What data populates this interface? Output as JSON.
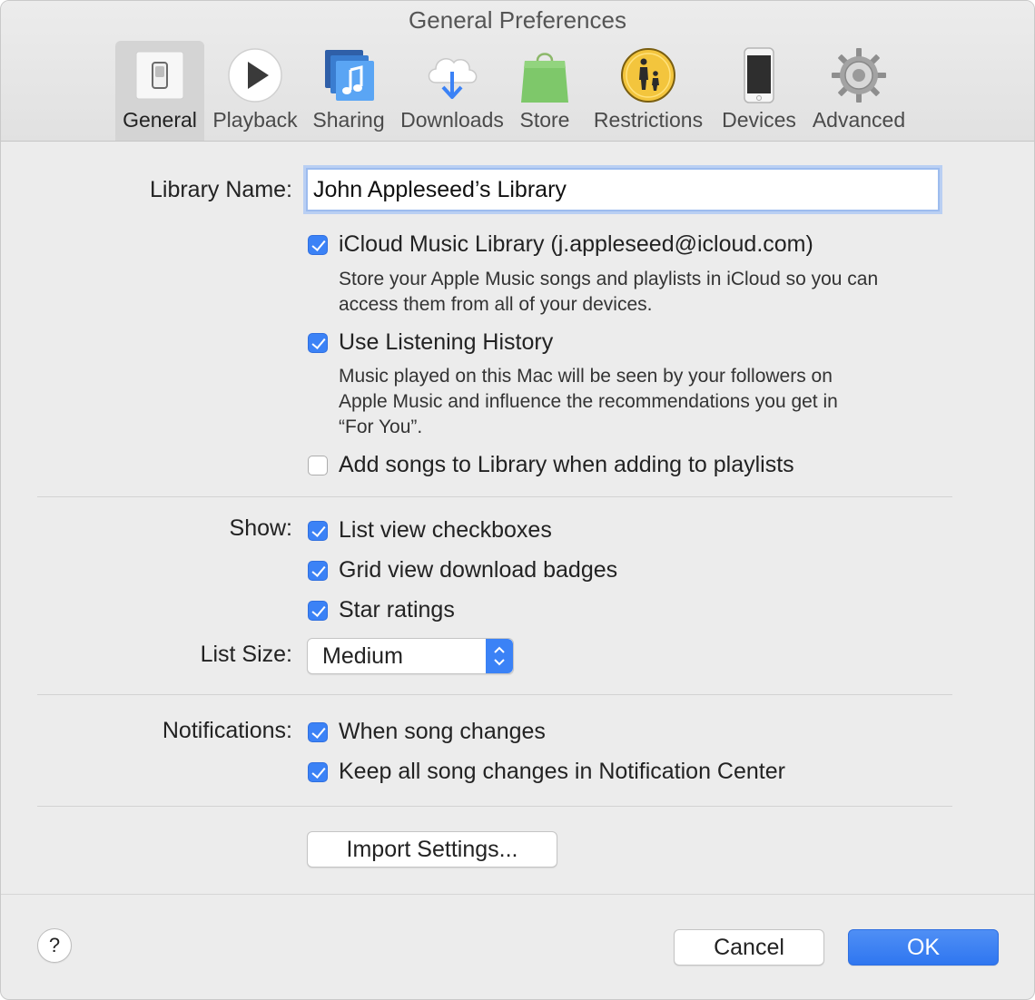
{
  "window": {
    "title": "General Preferences"
  },
  "toolbar": {
    "selected": "General",
    "tabs": [
      {
        "label": "General",
        "icon": "switch-icon"
      },
      {
        "label": "Playback",
        "icon": "play-icon"
      },
      {
        "label": "Sharing",
        "icon": "music-note-icon"
      },
      {
        "label": "Downloads",
        "icon": "cloud-download-icon"
      },
      {
        "label": "Store",
        "icon": "shopping-bag-icon"
      },
      {
        "label": "Restrictions",
        "icon": "parental-icon"
      },
      {
        "label": "Devices",
        "icon": "phone-icon"
      },
      {
        "label": "Advanced",
        "icon": "gear-icon"
      }
    ]
  },
  "library": {
    "label": "Library Name:",
    "value": "John Appleseed’s Library"
  },
  "options": {
    "icloud": {
      "label": "iCloud Music Library (j.appleseed@icloud.com)",
      "checked": true,
      "description": "Store your Apple Music songs and playlists in iCloud so you can access them from all of your devices."
    },
    "history": {
      "label": "Use Listening History",
      "checked": true,
      "description_lines": [
        "Music played on this Mac will be seen by your followers on",
        "Apple Music and influence the recommendations you get in",
        "“For You”."
      ]
    },
    "add_songs": {
      "label": "Add songs to Library when adding to playlists",
      "checked": false
    }
  },
  "show": {
    "label": "Show:",
    "items": [
      {
        "label": "List view checkboxes",
        "checked": true
      },
      {
        "label": "Grid view download badges",
        "checked": true
      },
      {
        "label": "Star ratings",
        "checked": true
      }
    ]
  },
  "list_size": {
    "label": "List Size:",
    "value": "Medium"
  },
  "notifications": {
    "label": "Notifications:",
    "items": [
      {
        "label": "When song changes",
        "checked": true
      },
      {
        "label": "Keep all song changes in Notification Center",
        "checked": true
      }
    ]
  },
  "import_settings": {
    "label": "Import Settings..."
  },
  "footer": {
    "help": "?",
    "cancel": "Cancel",
    "ok": "OK"
  },
  "colors": {
    "accent": "#3B82F6",
    "window_bg": "#ECECEC"
  }
}
